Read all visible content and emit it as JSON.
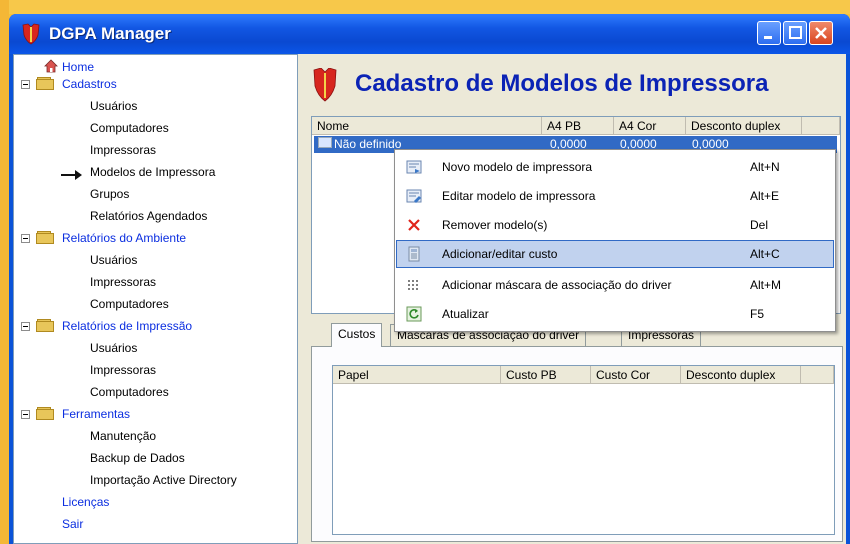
{
  "window": {
    "title": "DGPA Manager"
  },
  "tree": {
    "home": "Home",
    "cadastros": {
      "label": "Cadastros",
      "children": [
        "Usuários",
        "Computadores",
        "Impressoras",
        "Modelos de Impressora",
        "Grupos",
        "Relatórios Agendados"
      ]
    },
    "relatorios_ambiente": {
      "label": "Relatórios do Ambiente",
      "children": [
        "Usuários",
        "Impressoras",
        "Computadores"
      ]
    },
    "relatorios_impressao": {
      "label": "Relatórios de Impressão",
      "children": [
        "Usuários",
        "Impressoras",
        "Computadores"
      ]
    },
    "ferramentas": {
      "label": "Ferramentas",
      "children": [
        "Manutenção",
        "Backup de Dados",
        "Importação Active Directory"
      ]
    },
    "licencas": "Licenças",
    "sair": "Sair"
  },
  "page_title": "Cadastro de Modelos de Impressora",
  "models_table": {
    "columns": [
      "Nome",
      "A4 PB",
      "A4 Cor",
      "Desconto duplex"
    ],
    "rows": [
      {
        "nome": "Não definido",
        "a4pb": "0,0000",
        "a4cor": "0,0000",
        "duplex": "0,0000"
      }
    ]
  },
  "tabs": [
    "Custos",
    "Máscaras de associação do driver",
    "Impressoras"
  ],
  "cost_table": {
    "columns": [
      "Papel",
      "Custo PB",
      "Custo Cor",
      "Desconto duplex"
    ]
  },
  "context_menu": {
    "items": [
      {
        "label": "Novo modelo de impressora",
        "shortcut": "Alt+N",
        "icon": "new-model-icon"
      },
      {
        "label": "Editar modelo de impressora",
        "shortcut": "Alt+E",
        "icon": "edit-model-icon"
      },
      {
        "label": "Remover modelo(s)",
        "shortcut": "Del",
        "icon": "delete-x-icon"
      },
      {
        "label": "Adicionar/editar custo",
        "shortcut": "Alt+C",
        "icon": "cost-icon"
      },
      {
        "label": "Adicionar máscara de associação do driver",
        "shortcut": "Alt+M",
        "icon": "mask-icon"
      },
      {
        "label": "Atualizar",
        "shortcut": "F5",
        "icon": "refresh-icon"
      }
    ],
    "highlighted_index": 3
  },
  "colors": {
    "title_blue": "#0b23b5",
    "tree_link": "#0b2ee0",
    "selection": "#316ac5",
    "brand_red": "#d7261e"
  }
}
